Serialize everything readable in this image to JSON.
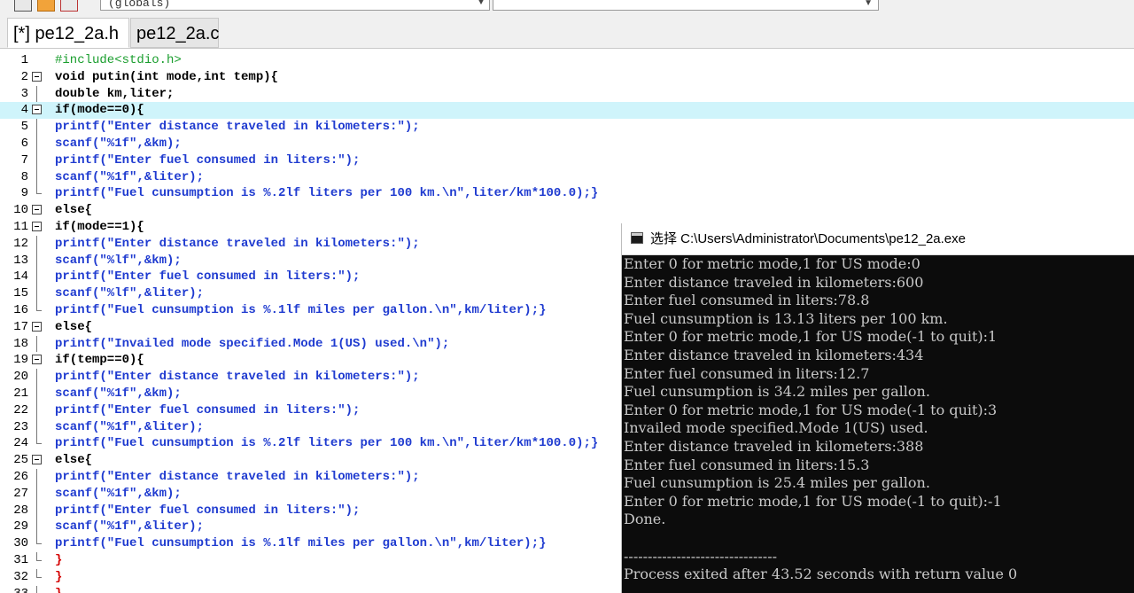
{
  "toolbar": {
    "scope_combo": "(globals)"
  },
  "tabs": [
    {
      "label": "[*] pe12_2a.h"
    },
    {
      "label": "pe12_2a.c"
    }
  ],
  "editor": {
    "highlight_line": 4,
    "lines": [
      {
        "n": "1",
        "text": "#include<stdio.h>",
        "style": "pp",
        "fold": "none"
      },
      {
        "n": "2",
        "text": "void putin(int mode,int temp){",
        "style": "plain",
        "fold": "box"
      },
      {
        "n": "3",
        "text": "double km,liter;",
        "style": "plain",
        "fold": "line"
      },
      {
        "n": "4",
        "text": "if(mode==0){",
        "style": "plain",
        "fold": "box"
      },
      {
        "n": "5",
        "text": "printf(\"Enter distance traveled in kilometers:\");",
        "style": "str",
        "fold": "line"
      },
      {
        "n": "6",
        "text": "scanf(\"%1f\",&km);",
        "style": "str",
        "fold": "line"
      },
      {
        "n": "7",
        "text": "printf(\"Enter fuel consumed in liters:\");",
        "style": "str",
        "fold": "line"
      },
      {
        "n": "8",
        "text": "scanf(\"%1f\",&liter);",
        "style": "str",
        "fold": "line"
      },
      {
        "n": "9",
        "text": "printf(\"Fuel cunsumption is %.2lf liters per 100 km.\\n\",liter/km*100.0);}",
        "style": "str",
        "fold": "end"
      },
      {
        "n": "10",
        "text": "else{",
        "style": "plain",
        "fold": "box"
      },
      {
        "n": "11",
        "text": "if(mode==1){",
        "style": "plain",
        "fold": "box"
      },
      {
        "n": "12",
        "text": "printf(\"Enter distance traveled in kilometers:\");",
        "style": "str",
        "fold": "line"
      },
      {
        "n": "13",
        "text": "scanf(\"%lf\",&km);",
        "style": "str",
        "fold": "line"
      },
      {
        "n": "14",
        "text": "printf(\"Enter fuel consumed in liters:\");",
        "style": "str",
        "fold": "line"
      },
      {
        "n": "15",
        "text": "scanf(\"%lf\",&liter);",
        "style": "str",
        "fold": "line"
      },
      {
        "n": "16",
        "text": "printf(\"Fuel cunsumption is %.1lf miles per gallon.\\n\",km/liter);}",
        "style": "str",
        "fold": "end"
      },
      {
        "n": "17",
        "text": "else{",
        "style": "plain",
        "fold": "box"
      },
      {
        "n": "18",
        "text": "printf(\"Invailed mode specified.Mode 1(US) used.\\n\");",
        "style": "str",
        "fold": "line"
      },
      {
        "n": "19",
        "text": "if(temp==0){",
        "style": "plain",
        "fold": "box"
      },
      {
        "n": "20",
        "text": "printf(\"Enter distance traveled in kilometers:\");",
        "style": "str",
        "fold": "line"
      },
      {
        "n": "21",
        "text": "scanf(\"%1f\",&km);",
        "style": "str",
        "fold": "line"
      },
      {
        "n": "22",
        "text": "printf(\"Enter fuel consumed in liters:\");",
        "style": "str",
        "fold": "line"
      },
      {
        "n": "23",
        "text": "scanf(\"%1f\",&liter);",
        "style": "str",
        "fold": "line"
      },
      {
        "n": "24",
        "text": "printf(\"Fuel cunsumption is %.2lf liters per 100 km.\\n\",liter/km*100.0);}",
        "style": "str",
        "fold": "end"
      },
      {
        "n": "25",
        "text": "else{",
        "style": "plain",
        "fold": "box"
      },
      {
        "n": "26",
        "text": "printf(\"Enter distance traveled in kilometers:\");",
        "style": "str",
        "fold": "line"
      },
      {
        "n": "27",
        "text": "scanf(\"%1f\",&km);",
        "style": "str",
        "fold": "line"
      },
      {
        "n": "28",
        "text": "printf(\"Enter fuel consumed in liters:\");",
        "style": "str",
        "fold": "line"
      },
      {
        "n": "29",
        "text": "scanf(\"%1f\",&liter);",
        "style": "str",
        "fold": "line"
      },
      {
        "n": "30",
        "text": "printf(\"Fuel cunsumption is %.1lf miles per gallon.\\n\",km/liter);}",
        "style": "str",
        "fold": "end"
      },
      {
        "n": "31",
        "text": "}",
        "style": "red",
        "fold": "end"
      },
      {
        "n": "32",
        "text": "}",
        "style": "red",
        "fold": "end"
      },
      {
        "n": "33",
        "text": "}",
        "style": "red",
        "fold": "end"
      }
    ]
  },
  "console": {
    "title": "选择 C:\\Users\\Administrator\\Documents\\pe12_2a.exe",
    "lines": [
      "Enter 0 for metric mode,1 for US mode:0",
      "Enter distance traveled in kilometers:600",
      "Enter fuel consumed in liters:78.8",
      "Fuel cunsumption is 13.13 liters per 100 km.",
      "Enter 0 for metric mode,1 for US mode(-1 to quit):1",
      "Enter distance traveled in kilometers:434",
      "Enter fuel consumed in liters:12.7",
      "Fuel cunsumption is 34.2 miles per gallon.",
      "Enter 0 for metric mode,1 for US mode(-1 to quit):3",
      "Invailed mode specified.Mode 1(US) used.",
      "Enter distance traveled in kilometers:388",
      "Enter fuel consumed in liters:15.3",
      "Fuel cunsumption is 25.4 miles per gallon.",
      "Enter 0 for metric mode,1 for US mode(-1 to quit):-1",
      "Done.",
      "",
      "--------------------------------",
      "Process exited after 43.52 seconds with return value 0"
    ]
  }
}
